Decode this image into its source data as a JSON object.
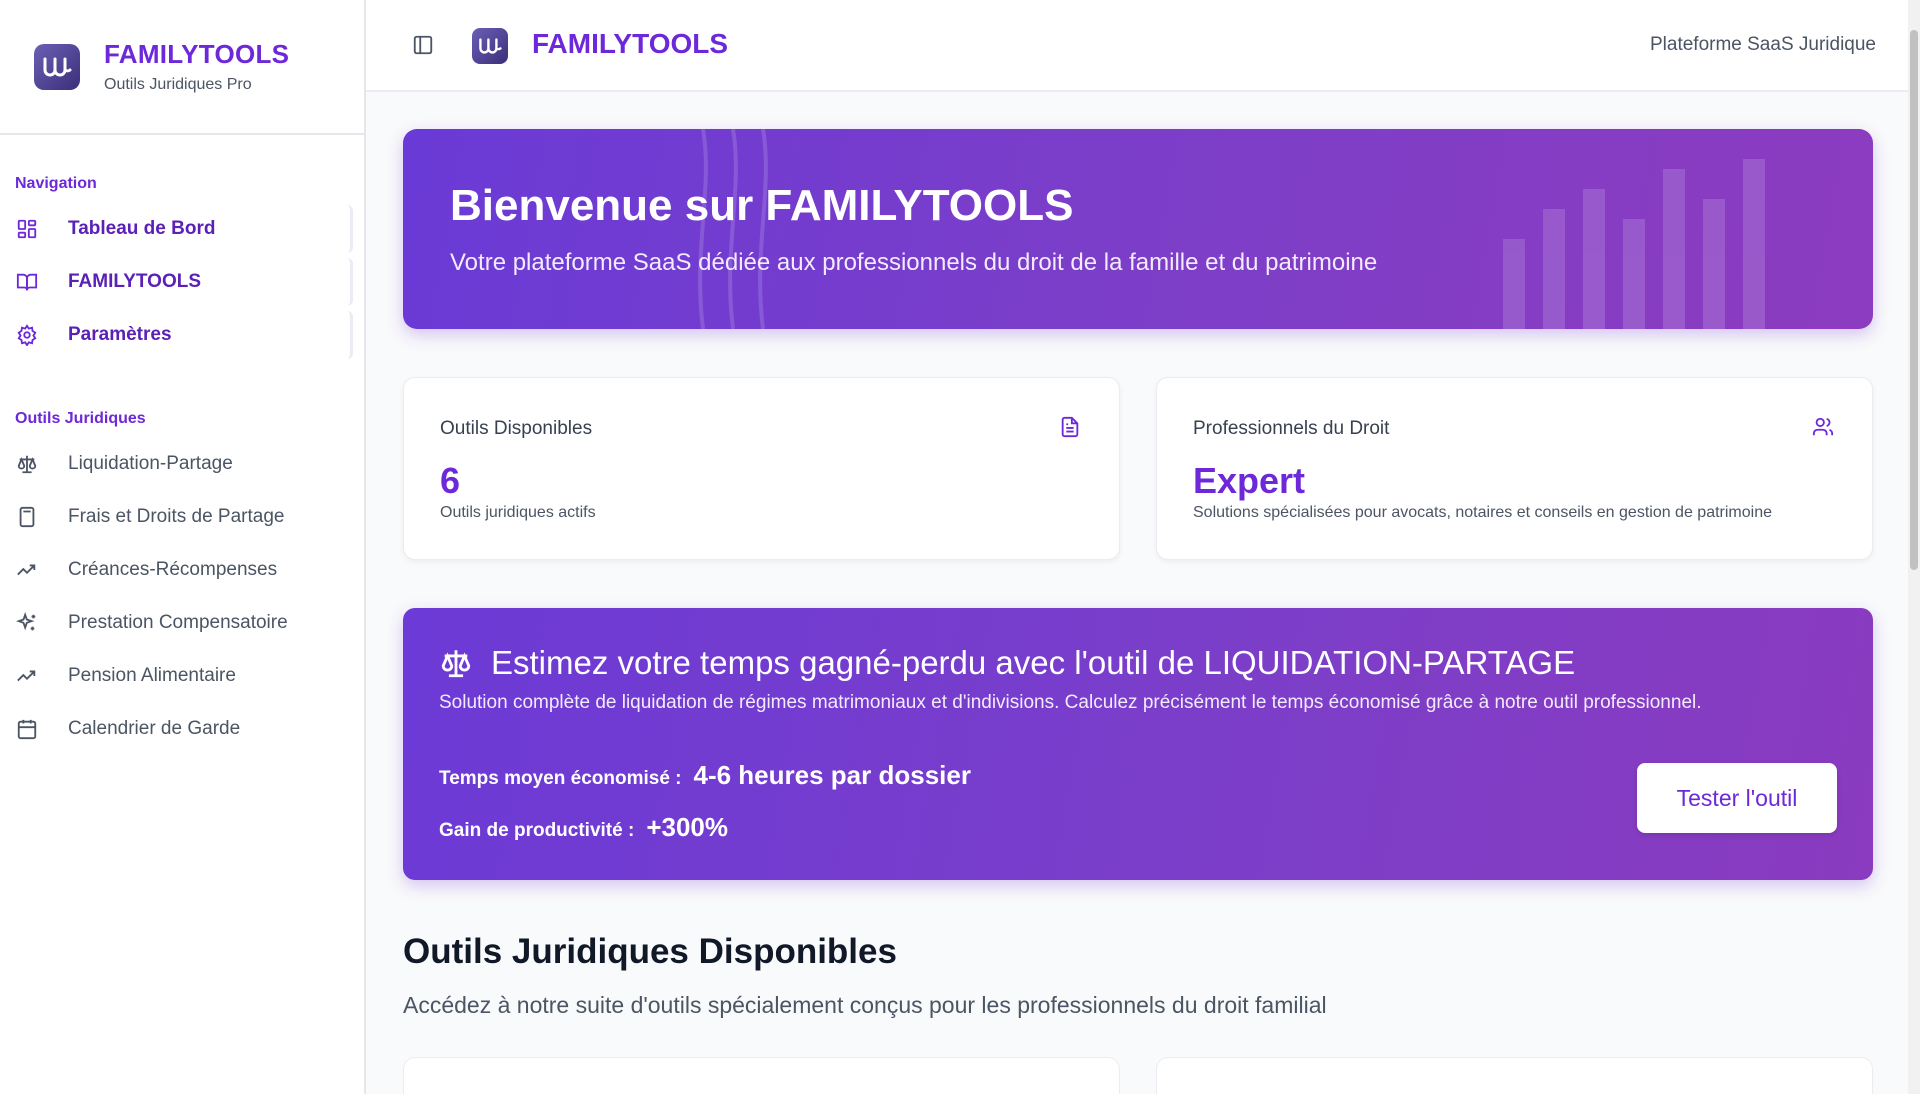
{
  "brand": {
    "title": "FAMILYTOOLS",
    "subtitle": "Outils Juridiques Pro"
  },
  "sidebar": {
    "nav_label": "Navigation",
    "nav_items": [
      {
        "label": "Tableau de Bord",
        "icon": "dashboard-icon"
      },
      {
        "label": "FAMILYTOOLS",
        "icon": "book-icon"
      },
      {
        "label": "Paramètres",
        "icon": "gear-icon"
      }
    ],
    "tools_label": "Outils Juridiques",
    "tool_items": [
      {
        "label": "Liquidation-Partage",
        "icon": "scale-icon"
      },
      {
        "label": "Frais et Droits de Partage",
        "icon": "calculator-icon"
      },
      {
        "label": "Créances-Récompenses",
        "icon": "trending-up-icon"
      },
      {
        "label": "Prestation Compensatoire",
        "icon": "sparkles-icon"
      },
      {
        "label": "Pension Alimentaire",
        "icon": "trending-up-icon"
      },
      {
        "label": "Calendrier de Garde",
        "icon": "calendar-icon"
      }
    ]
  },
  "header": {
    "title": "FAMILYTOOLS",
    "right_text": "Plateforme SaaS Juridique"
  },
  "hero": {
    "title": "Bienvenue sur FAMILYTOOLS",
    "subtitle": "Votre plateforme SaaS dédiée aux professionnels du droit de la famille et du patrimoine"
  },
  "cards": [
    {
      "label": "Outils Disponibles",
      "value": "6",
      "desc": "Outils juridiques actifs",
      "icon": "document-icon"
    },
    {
      "label": "Professionnels du Droit",
      "value": "Expert",
      "desc": "Solutions spécialisées pour avocats, notaires et conseils en gestion de patrimoine",
      "icon": "users-icon"
    }
  ],
  "promo": {
    "title": "Estimez votre temps gagné-perdu avec l'outil de LIQUIDATION-PARTAGE",
    "desc": "Solution complète de liquidation de régimes matrimoniaux et d'indivisions. Calculez précisément le temps économisé grâce à notre outil professionnel.",
    "stat1_label": "Temps moyen économisé :",
    "stat1_value": "4-6 heures par dossier",
    "stat2_label": "Gain de productivité :",
    "stat2_value": "+300%",
    "button_label": "Tester l'outil"
  },
  "section": {
    "title": "Outils Juridiques Disponibles",
    "subtitle": "Accédez à notre suite d'outils spécialement conçus pour les professionnels du droit familial"
  },
  "colors": {
    "accent": "#6d28d9",
    "gradient_start": "#6a3ad6",
    "gradient_end": "#8c3cc0"
  }
}
